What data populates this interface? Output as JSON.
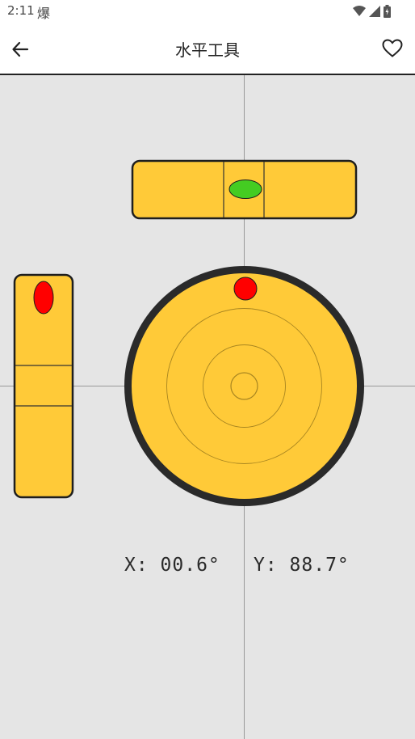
{
  "status_bar": {
    "time": "2:11",
    "app_glyph": "爆",
    "icons": [
      "wifi-icon",
      "signal-icon",
      "battery-icon"
    ]
  },
  "app_bar": {
    "title": "水平工具",
    "back_icon": "arrow-left-icon",
    "favorite_icon": "heart-outline-icon"
  },
  "level": {
    "x_label": "X: 00.6°",
    "y_label": "Y: 88.7°",
    "colors": {
      "background": "#e5e5e5",
      "vial_fill": "#ffca38",
      "bubble_ok": "#44cc22",
      "bubble_off": "#ff0000",
      "rim": "#2a2a2a"
    }
  }
}
